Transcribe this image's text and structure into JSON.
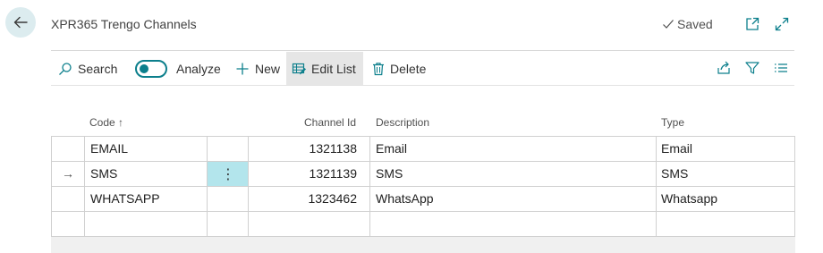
{
  "header": {
    "title": "XPR365 Trengo Channels",
    "saved_label": "Saved"
  },
  "actions": {
    "search": "Search",
    "analyze": "Analyze",
    "new": "New",
    "edit_list": "Edit List",
    "delete": "Delete"
  },
  "columns": {
    "code": "Code",
    "code_sort": "↑",
    "channel_id": "Channel Id",
    "description": "Description",
    "type": "Type"
  },
  "rows": [
    {
      "code": "EMAIL",
      "channel_id": "1321138",
      "description": "Email",
      "type": "Email"
    },
    {
      "code": "SMS",
      "channel_id": "1321139",
      "description": "SMS",
      "type": "SMS"
    },
    {
      "code": "WHATSAPP",
      "channel_id": "1323462",
      "description": "WhatsApp",
      "type": "Whatsapp"
    }
  ],
  "row_marker": "→",
  "row_menu_glyph": "⋮",
  "colors": {
    "accent": "#0c7f8c",
    "selected_cell": "#b3e5ec",
    "back_button_bg": "#dcecef"
  }
}
